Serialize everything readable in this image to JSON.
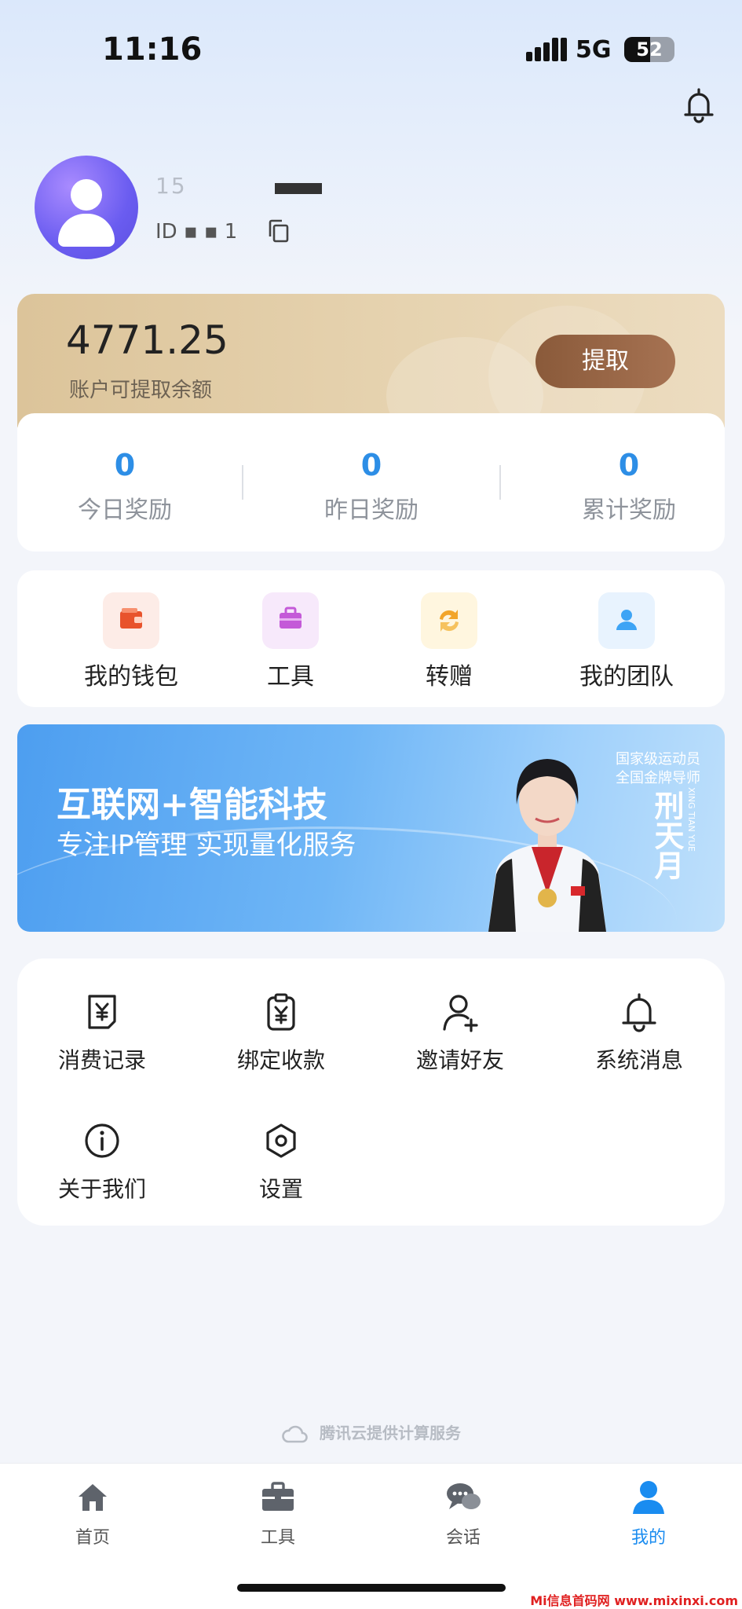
{
  "status_bar": {
    "time": "11:16",
    "network": "5G",
    "battery": "52",
    "battery_level": 0.52
  },
  "profile": {
    "name_masked": "15",
    "id_masked": "ID ▪ ▪   1"
  },
  "balance": {
    "amount": "4771.25",
    "label": "账户可提取余额",
    "withdraw_label": "提取"
  },
  "rewards": [
    {
      "value": "0",
      "label": "今日奖励"
    },
    {
      "value": "0",
      "label": "昨日奖励"
    },
    {
      "value": "0",
      "label": "累计奖励"
    }
  ],
  "quick_menu": [
    {
      "label": "我的钱包",
      "icon": "wallet-icon",
      "color": "#e8532c"
    },
    {
      "label": "工具",
      "icon": "toolbox-icon",
      "color": "#c45ad8"
    },
    {
      "label": "转赠",
      "icon": "transfer-icon",
      "color": "#f2a52a"
    },
    {
      "label": "我的团队",
      "icon": "team-icon",
      "color": "#3ea4f5"
    }
  ],
  "banner": {
    "title": "互联网+智能科技",
    "subtitle": "专注IP管理  实现量化服务",
    "tag_line1": "国家级运动员",
    "tag_line2": "全国金牌导师",
    "person_name": "刑天月",
    "person_pinyin": "XING TIAN YUE"
  },
  "services": [
    {
      "label": "消费记录",
      "icon": "receipt-icon"
    },
    {
      "label": "绑定收款",
      "icon": "bind-payment-icon"
    },
    {
      "label": "邀请好友",
      "icon": "invite-user-icon"
    },
    {
      "label": "系统消息",
      "icon": "bell-icon"
    },
    {
      "label": "关于我们",
      "icon": "info-icon"
    },
    {
      "label": "设置",
      "icon": "settings-icon"
    }
  ],
  "footer": {
    "provider_text": "腾讯云提供计算服务"
  },
  "tabbar": [
    {
      "label": "首页",
      "icon": "home-icon",
      "active": false
    },
    {
      "label": "工具",
      "icon": "briefcase-icon",
      "active": false
    },
    {
      "label": "会话",
      "icon": "chat-icon",
      "active": false
    },
    {
      "label": "我的",
      "icon": "user-icon",
      "active": true
    }
  ],
  "colors": {
    "accent": "#1a8cf0",
    "reward_value": "#2d8ee6",
    "withdraw_button": "#8a5a3a"
  },
  "watermark": "Mi信息首码网 www.mixinxi.com"
}
